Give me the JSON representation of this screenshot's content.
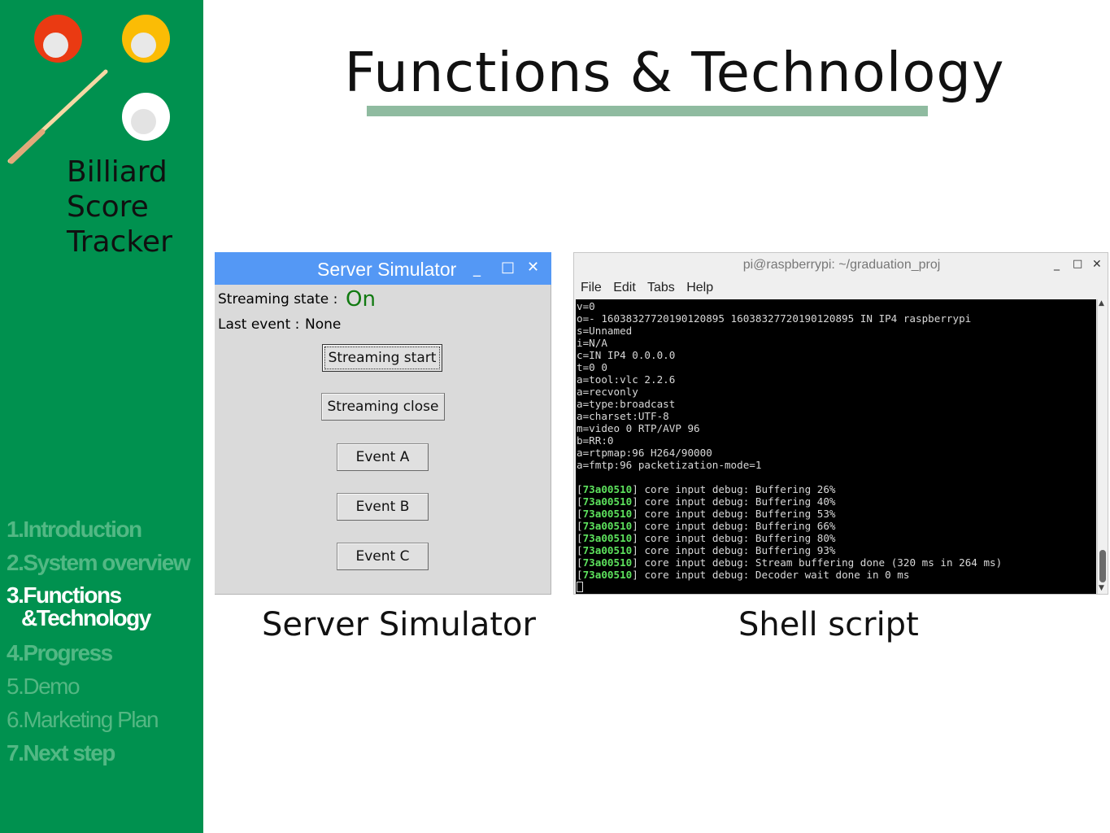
{
  "sidebar": {
    "brand_lines": [
      "Billiard",
      "Score",
      "Tracker"
    ],
    "nav": [
      {
        "label": "1.Introduction"
      },
      {
        "label": "2.System overview"
      },
      {
        "label_line1": "3.Functions",
        "label_line2": "&Technology"
      },
      {
        "label": "4.Progress"
      },
      {
        "label": "5.Demo"
      },
      {
        "label": "6.Marketing Plan"
      },
      {
        "label": "7.Next step"
      }
    ],
    "colors": {
      "background": "#00914f",
      "active": "#ffffff",
      "inactive": "#52b884"
    }
  },
  "slide": {
    "title": "Functions & Technology",
    "underline_color": "#8fbba0"
  },
  "server_simulator": {
    "window_title": "Server Simulator",
    "controls": {
      "minimize": "_",
      "maximize": "□",
      "close": "✕"
    },
    "streaming_state_label": "Streaming state :",
    "streaming_state_value": "On",
    "last_event_label": "Last event :",
    "last_event_value": "None",
    "buttons": {
      "streaming_start": "Streaming start",
      "streaming_close": "Streaming close",
      "event_a": "Event A",
      "event_b": "Event B",
      "event_c": "Event C"
    },
    "caption": "Server Simulator",
    "titlebar_color": "#5498f5"
  },
  "terminal": {
    "window_title": "pi@raspberrypi: ~/graduation_proj",
    "controls": {
      "minimize": "_",
      "maximize": "□",
      "close": "✕"
    },
    "menu": [
      "File",
      "Edit",
      "Tabs",
      "Help"
    ],
    "lines": [
      "v=0",
      "o=- 16038327720190120895 16038327720190120895 IN IP4 raspberrypi",
      "s=Unnamed",
      "i=N/A",
      "c=IN IP4 0.0.0.0",
      "t=0 0",
      "a=tool:vlc 2.2.6",
      "a=recvonly",
      "a=type:broadcast",
      "a=charset:UTF-8",
      "m=video 0 RTP/AVP 96",
      "b=RR:0",
      "a=rtpmap:96 H264/90000",
      "a=fmtp:96 packetization-mode=1",
      ""
    ],
    "debug_prefix_id": "73a00510",
    "debug_lines": [
      "core input debug: Buffering 26%",
      "core input debug: Buffering 40%",
      "core input debug: Buffering 53%",
      "core input debug: Buffering 66%",
      "core input debug: Buffering 80%",
      "core input debug: Buffering 93%",
      "core input debug: Stream buffering done (320 ms in 264 ms)",
      "core input debug: Decoder wait done in 0 ms"
    ],
    "caption": "Shell script"
  }
}
